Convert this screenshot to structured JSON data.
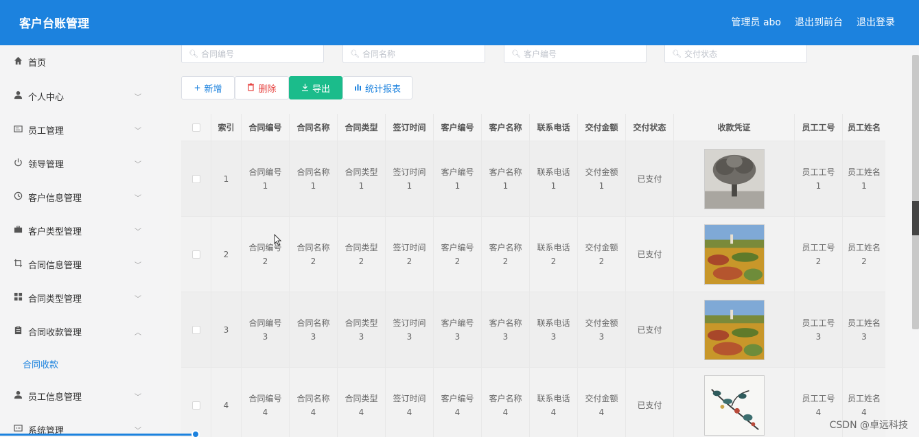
{
  "header": {
    "title": "客户台账管理",
    "links": [
      "管理员 abo",
      "退出到前台",
      "退出登录"
    ]
  },
  "sidebar": {
    "items": [
      {
        "label": "首页",
        "icon": "home-icon",
        "arrow": ""
      },
      {
        "label": "个人中心",
        "icon": "user-icon",
        "arrow": "down"
      },
      {
        "label": "员工管理",
        "icon": "id-card-icon",
        "arrow": "down"
      },
      {
        "label": "领导管理",
        "icon": "power-icon",
        "arrow": "down"
      },
      {
        "label": "客户信息管理",
        "icon": "clock-icon",
        "arrow": "down"
      },
      {
        "label": "客户类型管理",
        "icon": "briefcase-icon",
        "arrow": "down"
      },
      {
        "label": "合同信息管理",
        "icon": "crop-icon",
        "arrow": "down"
      },
      {
        "label": "合同类型管理",
        "icon": "grid-icon",
        "arrow": "down"
      },
      {
        "label": "合同收款管理",
        "icon": "clipboard-icon",
        "arrow": "up"
      },
      {
        "label": "员工信息管理",
        "icon": "user-icon",
        "arrow": "down"
      },
      {
        "label": "系统管理",
        "icon": "chat-icon",
        "arrow": "down"
      }
    ],
    "active_submenu": "合同收款"
  },
  "search": {
    "placeholders": [
      "合同编号",
      "合同名称",
      "客户编号",
      "交付状态"
    ]
  },
  "toolbar": {
    "add": "新增",
    "delete": "删除",
    "export": "导出",
    "report": "统计报表"
  },
  "table": {
    "columns": [
      "索引",
      "合同编号",
      "合同名称",
      "合同类型",
      "签订时间",
      "客户编号",
      "客户名称",
      "联系电话",
      "交付金额",
      "交付状态",
      "收款凭证",
      "员工工号",
      "员工姓名"
    ],
    "rows": [
      {
        "index": "1",
        "contract_no": "合同编号\n1",
        "contract_name": "合同名称\n1",
        "contract_type": "合同类型\n1",
        "sign_time": "签订时间\n1",
        "customer_no": "客户编号\n1",
        "customer_name": "客户名称\n1",
        "phone": "联系电话\n1",
        "amount": "交付金额\n1",
        "status": "已支付",
        "voucher": "tree-sketch-image",
        "emp_no": "员工工号\n1",
        "emp_name": "员工姓名\n1"
      },
      {
        "index": "2",
        "contract_no": "合同编号\n2",
        "contract_name": "合同名称\n2",
        "contract_type": "合同类型\n2",
        "sign_time": "签订时间\n2",
        "customer_no": "客户编号\n2",
        "customer_name": "客户名称\n2",
        "phone": "联系电话\n2",
        "amount": "交付金额\n2",
        "status": "已支付",
        "voucher": "landscape-painting-image",
        "emp_no": "员工工号\n2",
        "emp_name": "员工姓名\n2"
      },
      {
        "index": "3",
        "contract_no": "合同编号\n3",
        "contract_name": "合同名称\n3",
        "contract_type": "合同类型\n3",
        "sign_time": "签订时间\n3",
        "customer_no": "客户编号\n3",
        "customer_name": "客户名称\n3",
        "phone": "联系电话\n3",
        "amount": "交付金额\n3",
        "status": "已支付",
        "voucher": "landscape-painting-image",
        "emp_no": "员工工号\n3",
        "emp_name": "员工姓名\n3"
      },
      {
        "index": "4",
        "contract_no": "合同编号\n4",
        "contract_name": "合同名称\n4",
        "contract_type": "合同类型\n4",
        "sign_time": "签订时间\n4",
        "customer_no": "客户编号\n4",
        "customer_name": "客户名称\n4",
        "phone": "联系电话\n4",
        "amount": "交付金额\n4",
        "status": "已支付",
        "voucher": "ink-flower-image",
        "emp_no": "员工工号\n4",
        "emp_name": "员工姓名\n4"
      }
    ]
  },
  "watermark": "CSDN @卓远科技",
  "colors": {
    "primary": "#1c82de",
    "export_button": "#1bbc8b",
    "delete_text": "#e64340"
  }
}
